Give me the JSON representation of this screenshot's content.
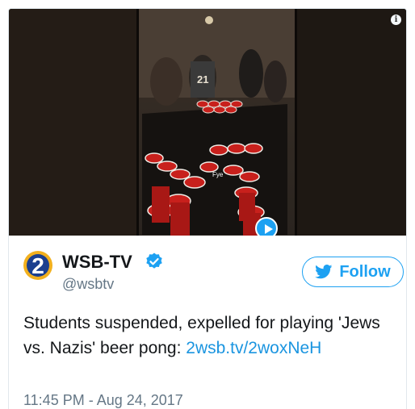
{
  "media": {
    "shirt_number": "21",
    "overlay_text": "Fye",
    "icons": [
      "info-icon",
      "play-icon"
    ]
  },
  "author": {
    "name": "WSB-TV",
    "handle": "@wsbtv",
    "avatar_digit": "2",
    "verified": true,
    "avatar_icon": "channel-2-logo",
    "verified_icon": "verified-badge-icon"
  },
  "follow": {
    "label": "Follow",
    "icon": "twitter-bird-icon"
  },
  "tweet": {
    "text": "Students suspended, expelled for playing 'Jews vs. Nazis' beer pong: ",
    "link": "2wsb.tv/2woxNeH",
    "timestamp": "11:45 PM - Aug 24, 2017"
  },
  "colors": {
    "accent": "#1da1f2",
    "link": "#1b95e0",
    "text": "#14171a",
    "secondary": "#657786",
    "avatar_gold": "#f2b01e",
    "avatar_blue": "#1b3f8f",
    "cup_red": "#c8201c"
  }
}
